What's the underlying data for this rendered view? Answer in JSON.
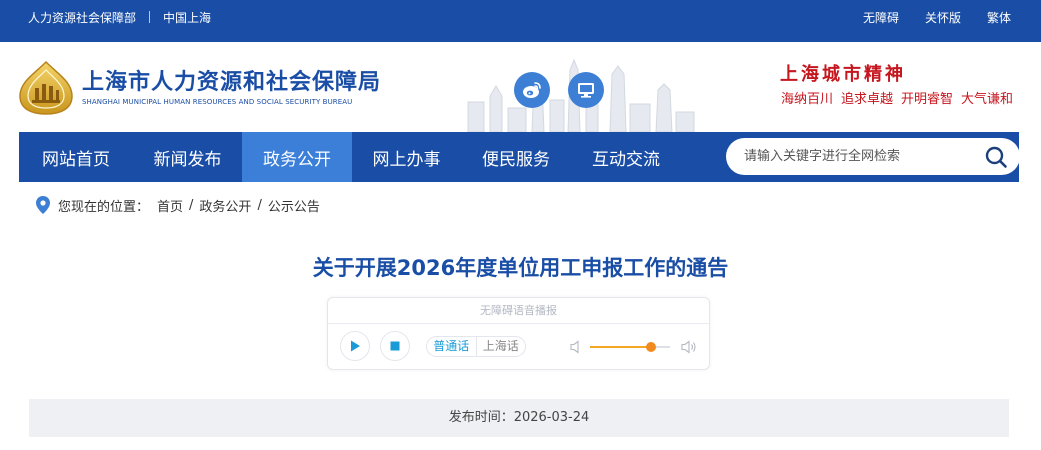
{
  "topbar": {
    "left_links": [
      "人力资源社会保障部",
      "中国上海"
    ],
    "right_links": [
      "无障碍",
      "关怀版",
      "繁体"
    ]
  },
  "header": {
    "org_name_cn": "上海市人力资源和社会保障局",
    "org_name_en": "SHANGHAI MUNICIPAL HUMAN RESOURCES AND SOCIAL SECURITY BUREAU",
    "spirit_title": "上海城市精神",
    "spirit_words": [
      "海纳百川",
      "追求卓越",
      "开明睿智",
      "大气谦和"
    ]
  },
  "nav": {
    "items": [
      "网站首页",
      "新闻发布",
      "政务公开",
      "网上办事",
      "便民服务",
      "互动交流"
    ],
    "active_index": 2,
    "search_placeholder": "请输入关键字进行全网检索"
  },
  "breadcrumb": {
    "label": "您现在的位置：",
    "items": [
      "首页",
      "政务公开",
      "公示公告"
    ]
  },
  "article": {
    "title": "关于开展2026年度单位用工申报工作的通告",
    "publish": "发布时间：2026-03-24"
  },
  "player": {
    "title": "无障碍语音播报",
    "lang_selected": "普通话",
    "lang_other": "上海话",
    "volume_percent": 76
  },
  "colors": {
    "brand_blue": "#1a4ea6",
    "nav_active": "#3b7fd9",
    "spirit_red": "#c6161e",
    "volume_orange": "#f28b1e"
  }
}
